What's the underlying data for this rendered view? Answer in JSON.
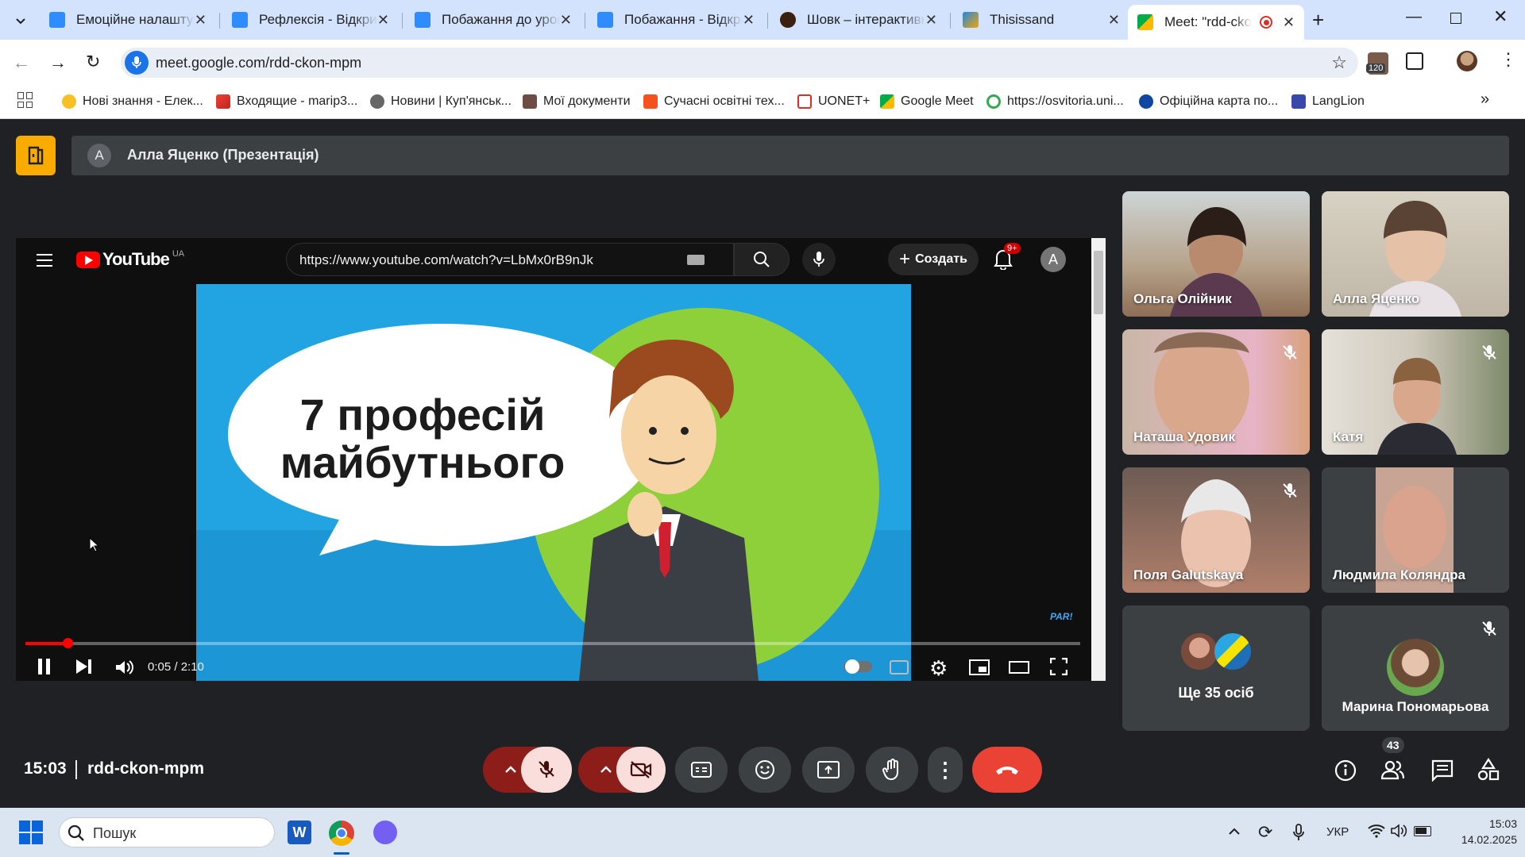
{
  "tabs": [
    {
      "title": "Емоційне налаштува",
      "icon": "wordwall-icon"
    },
    {
      "title": "Рефлексія - Відкрий",
      "icon": "wordwall-icon"
    },
    {
      "title": "Побажання до урок",
      "icon": "wordwall-icon"
    },
    {
      "title": "Побажання - Відкри",
      "icon": "wordwall-icon"
    },
    {
      "title": "Шовк – інтерактивн",
      "icon": "silk-icon"
    },
    {
      "title": "Thisissand",
      "icon": "sand-icon"
    },
    {
      "title": "Meet: \"rdd-ckon-",
      "icon": "meet-icon"
    }
  ],
  "address": {
    "url": "meet.google.com/rdd-ckon-mpm",
    "extension_badge": "120"
  },
  "bookmarks": [
    "Нові знання - Елек...",
    "Входящие - marip3...",
    "Новини | Куп'янськ...",
    "Мої документи",
    "Сучасні освітні тех...",
    "UONET+",
    "Google Meet",
    "https://osvitoria.uni...",
    "Офіційна карта по...",
    "LangLion"
  ],
  "meet": {
    "presenter_avatar": "А",
    "presenter_label": "Алла Яценко (Презентація)",
    "time": "15:03",
    "meeting_code": "rdd-ckon-mpm",
    "participants_count": "43",
    "more_people_label": "Ще 35 осіб",
    "participants": [
      {
        "name": "Ольга Олійник",
        "muted": false
      },
      {
        "name": "Алла Яценко",
        "muted": false
      },
      {
        "name": "Наташа Удовик",
        "muted": true
      },
      {
        "name": "Катя",
        "muted": true
      },
      {
        "name": "Поля Galutskaya",
        "muted": true
      },
      {
        "name": "Людмила Коляндра",
        "muted": false
      },
      {
        "name": "Марина Пономарьова",
        "muted": true
      }
    ]
  },
  "youtube": {
    "logo": "YouTube",
    "region": "UA",
    "search_value": "https://www.youtube.com/watch?v=LbMx0rB9nJk",
    "create_label": "Создать",
    "notif_badge": "9+",
    "avatar": "A",
    "video_title_line1": "7 професій",
    "video_title_line2": "майбутнього",
    "watermark": "PAR!",
    "time": "0:05 / 2:10",
    "progress_fraction": 0.04
  },
  "taskbar": {
    "search_placeholder": "Пошук",
    "lang": "УКР",
    "clock_time": "15:03",
    "clock_date": "14.02.2025"
  }
}
